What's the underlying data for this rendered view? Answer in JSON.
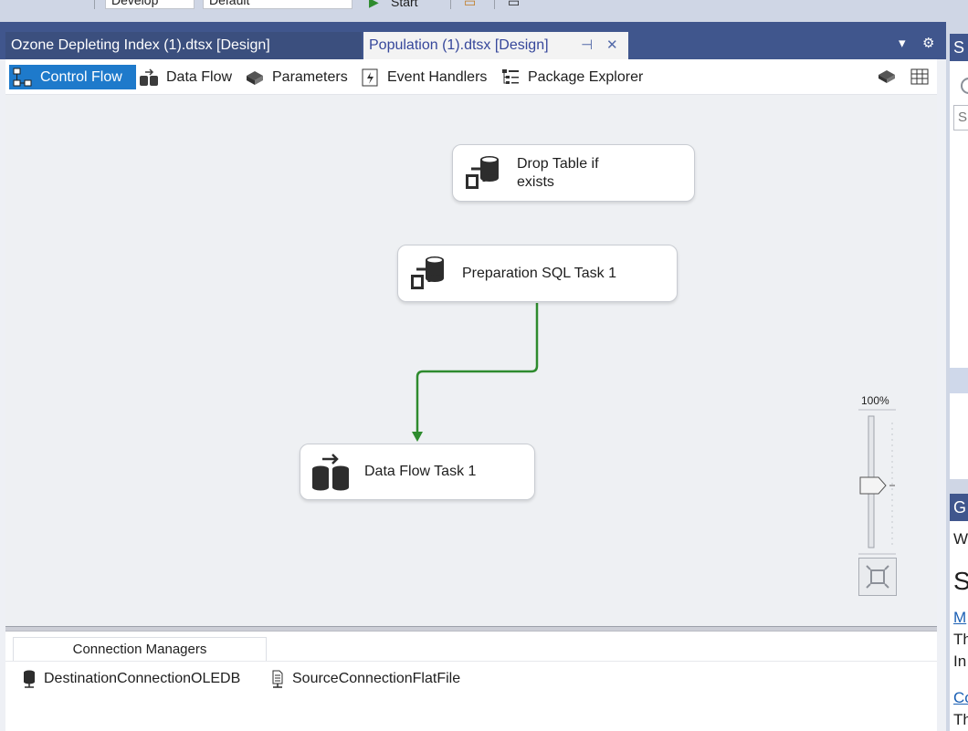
{
  "toolbar": {
    "configuration": "Develop",
    "platform": "Default",
    "start_label": "Start"
  },
  "tabs": [
    {
      "label": "Ozone Depleting Index (1).dtsx [Design]"
    },
    {
      "label": "Population (1).dtsx [Design]"
    }
  ],
  "designer_tabs": {
    "control_flow": "Control Flow",
    "data_flow": "Data Flow",
    "parameters": "Parameters",
    "event_handlers": "Event Handlers",
    "package_explorer": "Package Explorer"
  },
  "tasks": {
    "drop_table": {
      "label_line1": "Drop Table if",
      "label_line2": "exists"
    },
    "preparation": {
      "label": "Preparation SQL Task 1"
    },
    "data_flow": {
      "label": "Data Flow Task 1"
    }
  },
  "zoom": {
    "label": "100%",
    "level_percent": 100
  },
  "connection_managers": {
    "tab_label": "Connection Managers",
    "items": [
      {
        "label": "DestinationConnectionOLEDB",
        "icon": "database-connection-icon"
      },
      {
        "label": "SourceConnectionFlatFile",
        "icon": "flat-file-connection-icon"
      }
    ]
  },
  "right_panel": {
    "header1": "S",
    "header2": "G",
    "text_w": "W",
    "heading": "S",
    "link1": "M",
    "line_th1": "Th",
    "line_in": "In",
    "link2": "Co",
    "line_th2": "Th"
  },
  "colors": {
    "accent": "#1e7acb",
    "tab_strip": "#40568d",
    "connector": "#2e8b2e"
  }
}
